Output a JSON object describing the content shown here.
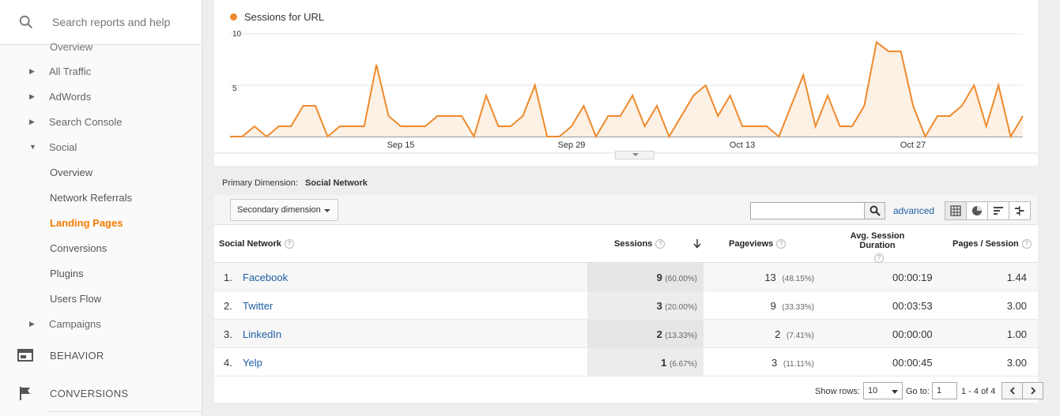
{
  "sidebar": {
    "search_placeholder": "Search reports and help",
    "overview_partial": "Overview",
    "items": [
      {
        "label": "All Traffic"
      },
      {
        "label": "AdWords"
      },
      {
        "label": "Search Console"
      },
      {
        "label": "Social"
      },
      {
        "label": "Overview"
      },
      {
        "label": "Network Referrals"
      },
      {
        "label": "Landing Pages"
      },
      {
        "label": "Conversions"
      },
      {
        "label": "Plugins"
      },
      {
        "label": "Users Flow"
      },
      {
        "label": "Campaigns"
      }
    ],
    "sections": [
      {
        "label": "BEHAVIOR",
        "icon": "behavior-icon"
      },
      {
        "label": "CONVERSIONS",
        "icon": "flag-icon"
      }
    ]
  },
  "chart": {
    "legend": "Sessions for URL",
    "color": "#ee8a2c"
  },
  "chart_data": {
    "type": "area",
    "series": [
      {
        "name": "Sessions for URL",
        "values": [
          0,
          0,
          1,
          0,
          1,
          1,
          3,
          3,
          0,
          1,
          1,
          1,
          7,
          2,
          1,
          1,
          1,
          2,
          2,
          2,
          0,
          4,
          1,
          1,
          2,
          5,
          0,
          0,
          1,
          3,
          0,
          2,
          2,
          4,
          1,
          3,
          0,
          2,
          4,
          5,
          2,
          4,
          1,
          1,
          1,
          0,
          3,
          6,
          1,
          4,
          1,
          1,
          3,
          9.2,
          8.3,
          8.3,
          3,
          0,
          2,
          2,
          3,
          5,
          1,
          5,
          0,
          2
        ]
      }
    ],
    "x_ticks": [
      "Sep 15",
      "Sep 29",
      "Oct 13",
      "Oct 27"
    ],
    "y_ticks": [
      "10",
      "5"
    ],
    "ylim": [
      0,
      10
    ]
  },
  "primary_dimension": {
    "label": "Primary Dimension:",
    "value": "Social Network"
  },
  "toolbar": {
    "secondary_dimension": "Secondary dimension",
    "advanced": "advanced"
  },
  "table": {
    "headers": {
      "network": "Social Network",
      "sessions": "Sessions",
      "pageviews": "Pageviews",
      "avg_duration": "Avg. Session Duration",
      "pages_session": "Pages / Session"
    },
    "rows": [
      {
        "idx": "1.",
        "network": "Facebook",
        "sessions": "9",
        "sessions_pct": "(60.00%)",
        "pageviews": "13",
        "pageviews_pct": "(48.15%)",
        "duration": "00:00:19",
        "pps": "1.44"
      },
      {
        "idx": "2.",
        "network": "Twitter",
        "sessions": "3",
        "sessions_pct": "(20.00%)",
        "pageviews": "9",
        "pageviews_pct": "(33.33%)",
        "duration": "00:03:53",
        "pps": "3.00"
      },
      {
        "idx": "3.",
        "network": "LinkedIn",
        "sessions": "2",
        "sessions_pct": "(13.33%)",
        "pageviews": "2",
        "pageviews_pct": "(7.41%)",
        "duration": "00:00:00",
        "pps": "1.00"
      },
      {
        "idx": "4.",
        "network": "Yelp",
        "sessions": "1",
        "sessions_pct": "(6.67%)",
        "pageviews": "3",
        "pageviews_pct": "(11.11%)",
        "duration": "00:00:45",
        "pps": "3.00"
      }
    ]
  },
  "footer": {
    "show_rows_label": "Show rows:",
    "show_rows_value": "10",
    "goto_label": "Go to:",
    "goto_value": "1",
    "range": "1 - 4 of 4"
  }
}
